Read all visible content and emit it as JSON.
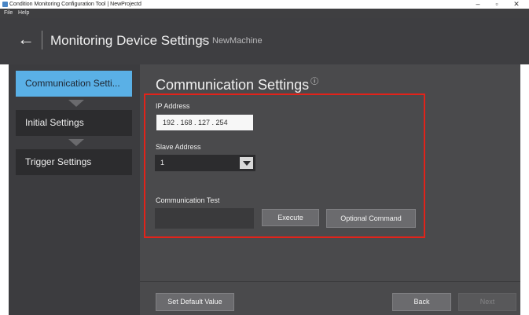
{
  "window": {
    "title": "Condition Monitoring Configuration Tool | NewProjectd",
    "minimize": "–",
    "maximize": "▫",
    "close": "✕"
  },
  "menu": {
    "items": [
      "File",
      "Help"
    ]
  },
  "header": {
    "back": "←",
    "title": "Monitoring Device Settings",
    "separator": ">",
    "crumb": "NewMachine"
  },
  "sidebar": {
    "steps": [
      {
        "label": "Communication Setti...",
        "active": true
      },
      {
        "label": "Initial Settings",
        "active": false
      },
      {
        "label": "Trigger Settings",
        "active": false
      }
    ]
  },
  "main": {
    "title": "Communication Settings",
    "info_icon": "ⓘ",
    "ip_label": "IP Address",
    "ip_value": "192 . 168 . 127 . 254",
    "slave_label": "Slave Address",
    "slave_value": "1",
    "test_label": "Communication Test",
    "execute": "Execute",
    "optional_command": "Optional Command"
  },
  "footer": {
    "set_default": "Set Default Value",
    "back": "Back",
    "next": "Next"
  },
  "colors": {
    "active_step": "#5ab0e6",
    "highlight_box": "#e2231a",
    "header_bg": "#3e3e41",
    "content_bg": "#4a4a4c"
  }
}
